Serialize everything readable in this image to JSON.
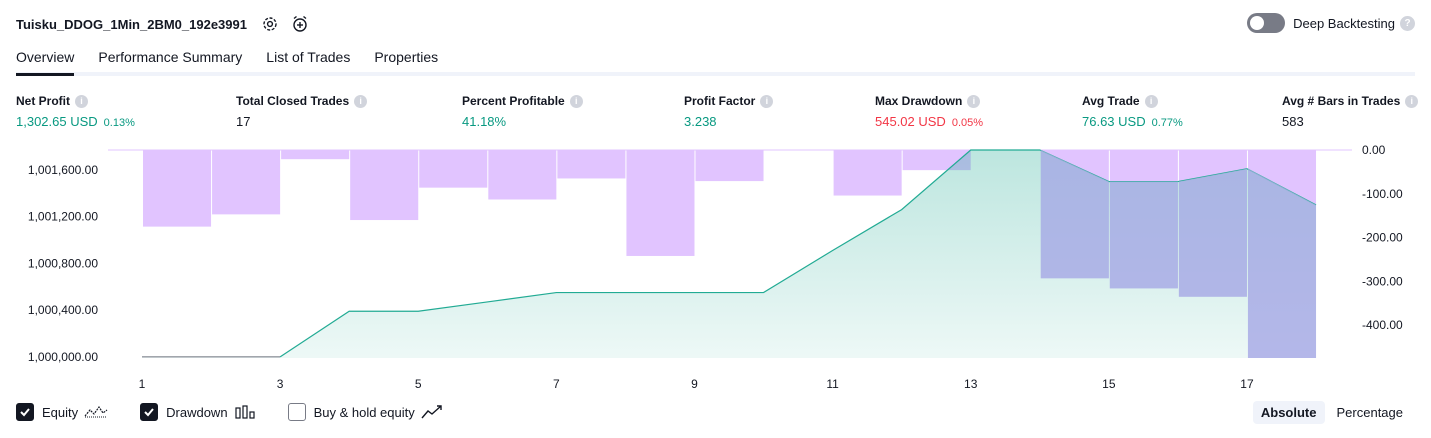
{
  "header": {
    "strategy_name": "Tuisku_DDOG_1Min_2BM0_192e3991",
    "settings_icon": "gear-icon",
    "alert_icon": "add-alarm-icon"
  },
  "deep_backtesting": {
    "label": "Deep Backtesting",
    "enabled": false,
    "help": "?"
  },
  "tabs": [
    {
      "label": "Overview",
      "active": true
    },
    {
      "label": "Performance Summary",
      "active": false
    },
    {
      "label": "List of Trades",
      "active": false
    },
    {
      "label": "Properties",
      "active": false
    }
  ],
  "stats": {
    "net_profit": {
      "label": "Net Profit",
      "value": "1,302.65 USD",
      "pct": "0.13%",
      "tone": "positive"
    },
    "total_closed_trades": {
      "label": "Total Closed Trades",
      "value": "17",
      "tone": "neutral"
    },
    "percent_profitable": {
      "label": "Percent Profitable",
      "value": "41.18%",
      "tone": "positive"
    },
    "profit_factor": {
      "label": "Profit Factor",
      "value": "3.238",
      "tone": "positive"
    },
    "max_drawdown": {
      "label": "Max Drawdown",
      "value": "545.02 USD",
      "pct": "0.05%",
      "tone": "negative"
    },
    "avg_trade": {
      "label": "Avg Trade",
      "value": "76.63 USD",
      "pct": "0.77%",
      "tone": "positive"
    },
    "avg_bars": {
      "label": "Avg # Bars in Trades",
      "value": "583",
      "tone": "neutral"
    }
  },
  "legend": {
    "equity": {
      "label": "Equity",
      "checked": true
    },
    "drawdown": {
      "label": "Drawdown",
      "checked": true
    },
    "buy_hold": {
      "label": "Buy & hold equity",
      "checked": false
    }
  },
  "mode": {
    "absolute": "Absolute",
    "percentage": "Percentage",
    "selected": "Absolute"
  },
  "colors": {
    "positive": "#089981",
    "negative": "#f23645",
    "drawdown_bar": "#e1c4ff",
    "equity_line": "#22ab94",
    "equity_fill": "#d5f0e8",
    "overlap": "#a9b3e4"
  },
  "chart_data": {
    "type": "area",
    "title": "",
    "xlabel": "",
    "ylabel": "",
    "x_ticks": [
      "1",
      "3",
      "5",
      "7",
      "9",
      "11",
      "13",
      "15",
      "17"
    ],
    "y_left_ticks": [
      "1,000,000.00",
      "1,000,400.00",
      "1,000,800.00",
      "1,001,200.00",
      "1,001,600.00"
    ],
    "y_right_ticks": [
      "0.00",
      "-100.00",
      "-200.00",
      "-300.00",
      "-400.00"
    ],
    "y_left_range": [
      999990,
      1001770
    ],
    "y_right_range": [
      -475,
      0
    ],
    "grid": false,
    "series": [
      {
        "name": "Equity",
        "kind": "area",
        "axis": "left",
        "x": [
          1,
          2,
          3,
          4,
          5,
          6,
          7,
          8,
          9,
          10,
          11,
          12,
          13,
          14,
          15,
          16,
          17,
          18
        ],
        "values": [
          1000000,
          1000000,
          1000000,
          1000390,
          1000390,
          1000470,
          1000550,
          1000550,
          1000550,
          1000550,
          1000910,
          1001260,
          1001770,
          1001770,
          1001500,
          1001500,
          1001610,
          1001300
        ]
      },
      {
        "name": "Drawdown",
        "kind": "bar",
        "axis": "right",
        "x": [
          2,
          3,
          4,
          5,
          6,
          7,
          8,
          9,
          10,
          11,
          12,
          13,
          14,
          15,
          16,
          17,
          18
        ],
        "values": [
          -175,
          -147,
          -21,
          -160,
          -86,
          -113,
          -65,
          -242,
          -71,
          0,
          -104,
          -46,
          0,
          -293,
          -316,
          -335,
          -475
        ]
      }
    ]
  }
}
